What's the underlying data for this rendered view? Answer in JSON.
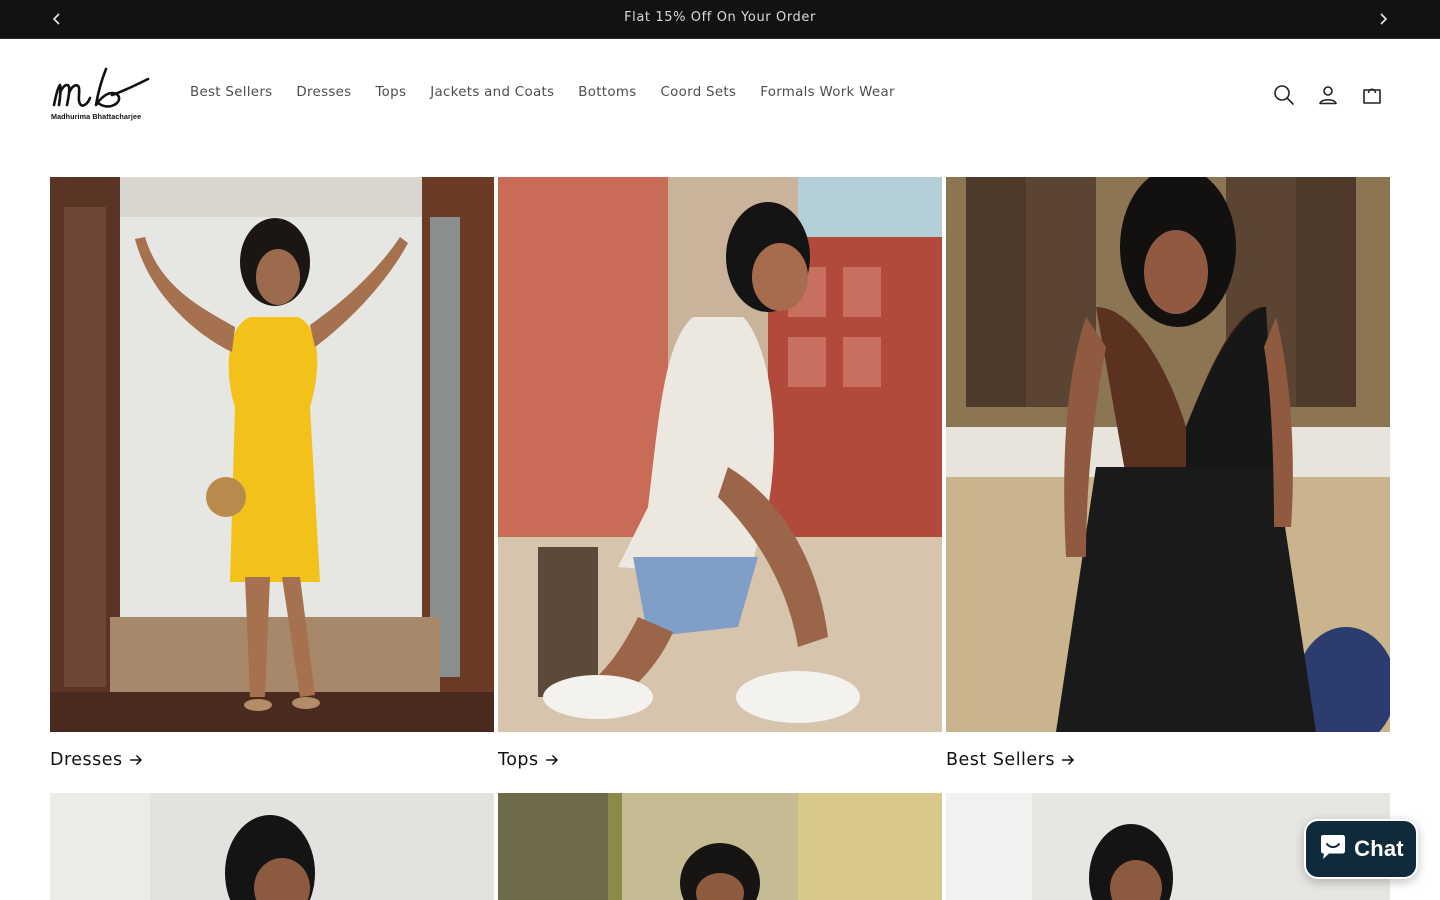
{
  "announcement": {
    "text": "Flat 15% Off On Your Order",
    "prev_icon": "chevron-left-icon",
    "next_icon": "chevron-right-icon"
  },
  "brand": {
    "logo_mark": "mb",
    "logo_name": "Madhurima Bhattacharjee"
  },
  "nav": {
    "items": [
      {
        "label": "Best Sellers"
      },
      {
        "label": "Dresses"
      },
      {
        "label": "Tops"
      },
      {
        "label": "Jackets and Coats"
      },
      {
        "label": "Bottoms"
      },
      {
        "label": "Coord Sets"
      },
      {
        "label": "Formals Work Wear"
      }
    ]
  },
  "header_icons": [
    "search-icon",
    "account-icon",
    "cart-icon"
  ],
  "collections": [
    {
      "title": "Dresses"
    },
    {
      "title": "Tops"
    },
    {
      "title": "Best Sellers"
    }
  ],
  "chat": {
    "label": "Chat",
    "icon": "chat-bubble-icon",
    "color": "#0f2a3a"
  },
  "colors": {
    "announcement_bg": "#121212",
    "text": "#121212",
    "nav_text": "#4d4d4d"
  }
}
